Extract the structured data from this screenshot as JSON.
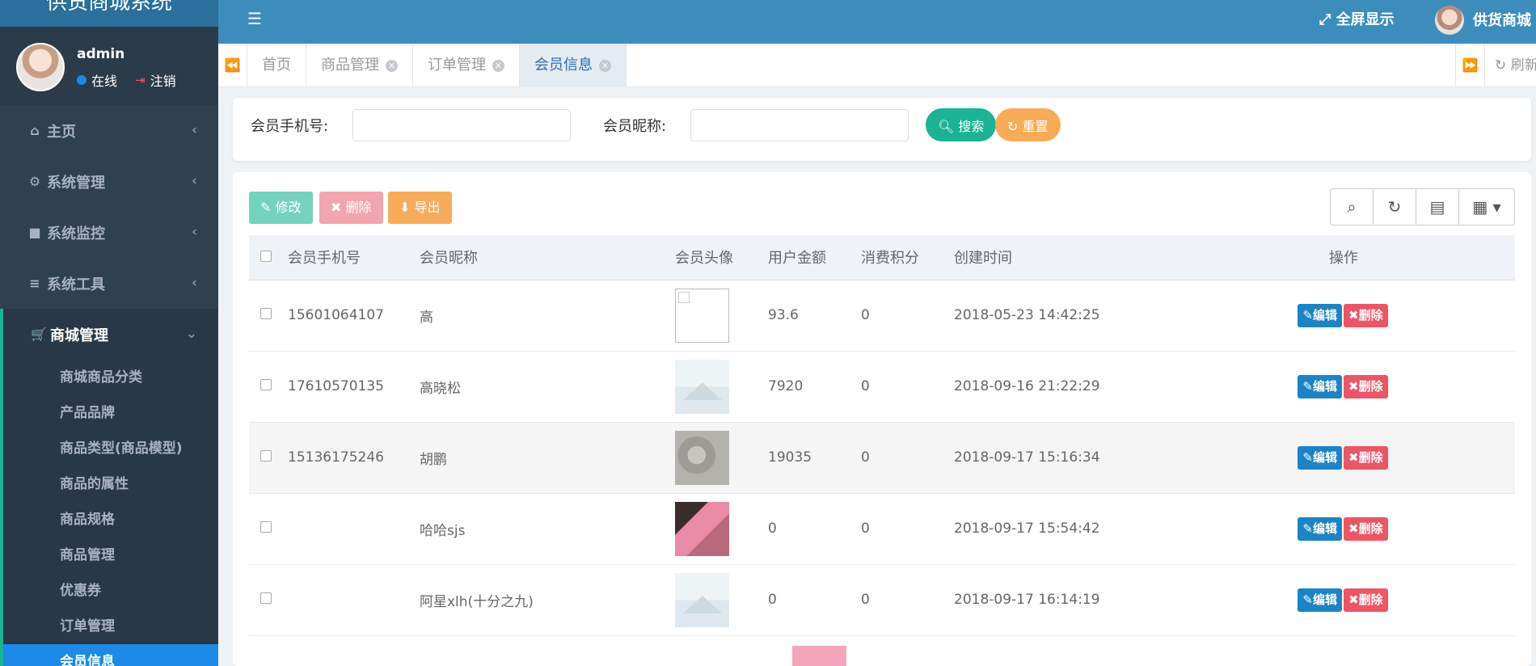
{
  "app": {
    "logo": "供货商城系统"
  },
  "user": {
    "name": "admin",
    "status": "在线",
    "logout": "注销"
  },
  "sidebar": {
    "items": [
      {
        "icon": "home-icon",
        "glyph": "⌂",
        "label": "主页"
      },
      {
        "icon": "gear-icon",
        "glyph": "⚙",
        "label": "系统管理"
      },
      {
        "icon": "video-camera-icon",
        "glyph": "■",
        "label": "系统监控"
      },
      {
        "icon": "bars-icon",
        "glyph": "≡",
        "label": "系统工具"
      },
      {
        "icon": "cart-icon",
        "glyph": "🛒",
        "label": "商城管理"
      }
    ],
    "sub_items": [
      "商城商品分类",
      "产品品牌",
      "商品类型(商品模型)",
      "商品的属性",
      "商品规格",
      "商品管理",
      "优惠券",
      "订单管理",
      "会员信息"
    ]
  },
  "topbar": {
    "fullscreen": "全屏显示",
    "user": "供货商城"
  },
  "tabs": {
    "items": [
      {
        "label": "首页",
        "closable": false
      },
      {
        "label": "商品管理",
        "closable": true
      },
      {
        "label": "订单管理",
        "closable": true
      },
      {
        "label": "会员信息",
        "closable": true,
        "active": true
      }
    ],
    "refresh": "刷新"
  },
  "search": {
    "phone_label": "会员手机号:",
    "nickname_label": "会员昵称:",
    "search_btn": "搜索",
    "reset_btn": "重置"
  },
  "toolbar": {
    "edit": "修改",
    "delete": "删除",
    "export": "导出"
  },
  "table": {
    "headers": [
      "会员手机号",
      "会员昵称",
      "会员头像",
      "用户金额",
      "消费积分",
      "创建时间",
      "操作"
    ],
    "edit_label": "编辑",
    "delete_label": "删除",
    "rows": [
      {
        "phone": "15601064107",
        "nickname": "高",
        "avatar": "broken",
        "amount": "93.6",
        "points": "0",
        "created": "2018-05-23 14:42:25"
      },
      {
        "phone": "17610570135",
        "nickname": "高晓松",
        "avatar": "placeholder",
        "amount": "7920",
        "points": "0",
        "created": "2018-09-16 21:22:29"
      },
      {
        "phone": "15136175246",
        "nickname": "胡鹏",
        "avatar": "photo-grey",
        "amount": "19035",
        "points": "0",
        "created": "2018-09-17 15:16:34"
      },
      {
        "phone": "",
        "nickname": "哈哈sjs",
        "avatar": "photo-pink",
        "amount": "0",
        "points": "0",
        "created": "2018-09-17 15:54:42"
      },
      {
        "phone": "",
        "nickname": "阿星xlh(十分之九)",
        "avatar": "placeholder",
        "amount": "0",
        "points": "0",
        "created": "2018-09-17 16:14:19"
      }
    ]
  }
}
